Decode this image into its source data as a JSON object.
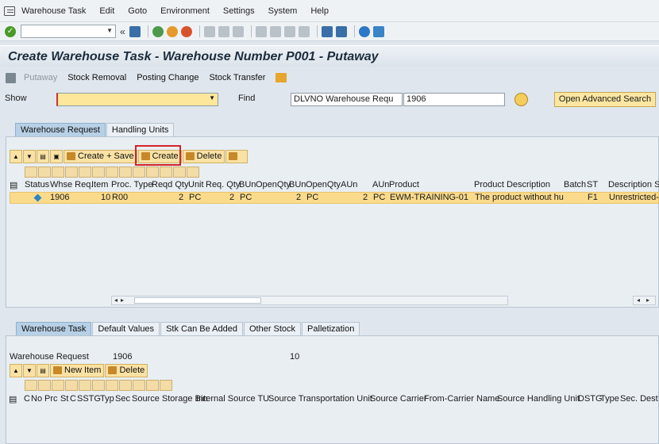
{
  "menu": {
    "items": [
      "Warehouse Task",
      "Edit",
      "Goto",
      "Environment",
      "Settings",
      "System",
      "Help"
    ]
  },
  "toolbar": {
    "back_symbol": "«",
    "icons": [
      "enter-icon",
      "save-icon",
      "back-icon",
      "exit-icon",
      "cancel-icon",
      "print-icon",
      "find-icon",
      "find-next-icon",
      "first-page-icon",
      "prev-page-icon",
      "next-page-icon",
      "last-page-icon",
      "new-session-icon",
      "shortcut-icon",
      "help-icon",
      "customize-icon"
    ]
  },
  "title": "Create Warehouse Task - Warehouse Number P001 - Putaway",
  "app_toolbar": {
    "putaway": "Putaway",
    "stock_removal": "Stock Removal",
    "posting_change": "Posting Change",
    "stock_transfer": "Stock Transfer"
  },
  "selection": {
    "show_label": "Show",
    "show_value": "",
    "find_label": "Find",
    "find_field": "DLVNO Warehouse Requ",
    "find_value": "1906",
    "advanced_search": "Open Advanced Search"
  },
  "upper_tabs": [
    "Warehouse Request",
    "Handling Units"
  ],
  "upper_grid_toolbar": {
    "create_save": "Create + Save",
    "create": "Create",
    "delete": "Delete"
  },
  "table": {
    "columns": [
      "Status",
      "Whse Req.",
      "Item",
      "Proc. Type",
      "Reqd Qty",
      "Unit",
      "Req. Qty",
      "BUn",
      "OpenQty",
      "BUn",
      "OpenQtyAUn",
      "AUn",
      "Product",
      "Product Description",
      "Batch",
      "ST",
      "Description S"
    ],
    "row": {
      "whse_req": "1906",
      "item": "10",
      "proc_type": "R00",
      "reqd_qty": "2",
      "unit": "PC",
      "req_qty": "2",
      "bun": "PC",
      "open_qty": "2",
      "open_bun": "PC",
      "open_qty_aun": "2",
      "aun": "PC",
      "product": "EWM-TRAINING-01",
      "product_desc": "The product without hu",
      "st": "F1",
      "st_desc": "Unrestricted-"
    }
  },
  "lower_tabs": [
    "Warehouse Task",
    "Default Values",
    "Stk Can Be Added",
    "Other Stock",
    "Palletization"
  ],
  "warehouse_request": {
    "label": "Warehouse Request",
    "number": "1906",
    "item": "10"
  },
  "lower_grid_toolbar": {
    "new_item": "New Item",
    "delete": "Delete"
  },
  "lower_columns": [
    "C",
    "No",
    "Prc",
    "St",
    "C",
    "SSTG",
    "Typ",
    "Sec",
    "Source Storage Bin",
    "Internal Source TU",
    "Source Transportation Unit",
    "Source Carrier",
    "From-Carrier Name",
    "Source Handling Unit",
    "DSTG",
    "Type",
    "Sec. Dest"
  ]
}
